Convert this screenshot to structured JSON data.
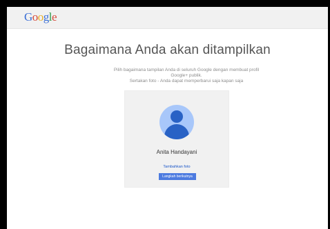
{
  "header": {
    "logo_letters": [
      "G",
      "o",
      "o",
      "g",
      "l",
      "e"
    ],
    "logo_colors": [
      "#3b6fd6",
      "#d64a3b",
      "#e8b02a",
      "#3b6fd6",
      "#2f9c4a",
      "#d64a3b"
    ]
  },
  "main": {
    "heading": "Bagaimana Anda akan ditampilkan",
    "description_line1": "Pilih bagaimana tampilan Anda di seluruh Google dengan membuat profil",
    "description_line2": "Google+ publik.",
    "description_line3": "Sertakan foto - Anda dapat memperbarui saja kapan saja"
  },
  "profile_card": {
    "name": "Anita Handayani",
    "add_photo_label": "Tambahkan foto",
    "next_button_label": "Langkah berikutnya",
    "accent_color": "#4d7be0"
  }
}
